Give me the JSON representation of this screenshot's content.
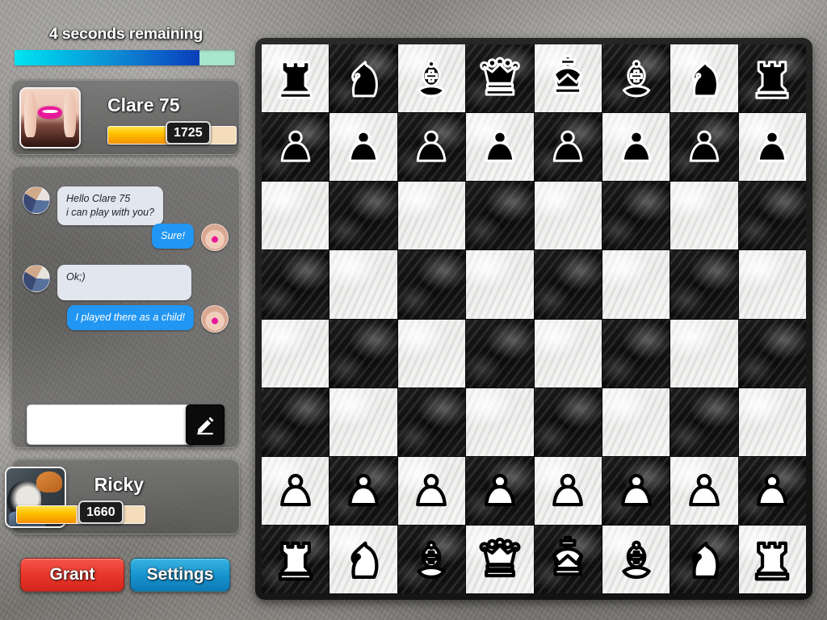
{
  "timer": {
    "label": "4 seconds remaining",
    "fill_percent": 84,
    "fill_color": "#0d8ad2",
    "track_color": "#a8e6cd"
  },
  "players": {
    "top": {
      "name": "Clare 75",
      "elo": "1725",
      "elo_fill_percent": 46,
      "avatar_name": "clare-avatar"
    },
    "bottom": {
      "name": "Ricky",
      "elo": "1660",
      "elo_fill_percent": 46,
      "avatar_name": "ricky-avatar"
    }
  },
  "chat": {
    "messages": [
      {
        "id": 0,
        "from": "them",
        "text": "Hello Clare 75\ni can play with you?"
      },
      {
        "id": 1,
        "from": "me",
        "text": "Sure!"
      },
      {
        "id": 2,
        "from": "them",
        "text": "Ok;)"
      },
      {
        "id": 3,
        "from": "me",
        "text": "I played there as a child!"
      }
    ],
    "input": {
      "value": "",
      "placeholder": ""
    },
    "send_icon": "pencil-icon"
  },
  "buttons": {
    "grant": "Grant",
    "settings": "Settings",
    "grant_color": "#e8352a",
    "settings_color": "#1694cf"
  },
  "board": {
    "light_color": "#f0f0ee",
    "dark_color": "#161616",
    "rows": [
      [
        "br",
        "bn",
        "bb",
        "bq",
        "bk",
        "bb",
        "bn",
        "br"
      ],
      [
        "bp",
        "bp",
        "bp",
        "bp",
        "bp",
        "bp",
        "bp",
        "bp"
      ],
      [
        "",
        "",
        "",
        "",
        "",
        "",
        "",
        ""
      ],
      [
        "",
        "",
        "",
        "",
        "",
        "",
        "",
        ""
      ],
      [
        "",
        "",
        "",
        "",
        "",
        "",
        "",
        ""
      ],
      [
        "",
        "",
        "",
        "",
        "",
        "",
        "",
        ""
      ],
      [
        "wp",
        "wp",
        "wp",
        "wp",
        "wp",
        "wp",
        "wp",
        "wp"
      ],
      [
        "wr",
        "wn",
        "wb",
        "wq",
        "wk",
        "wb",
        "wn",
        "wr"
      ]
    ]
  }
}
